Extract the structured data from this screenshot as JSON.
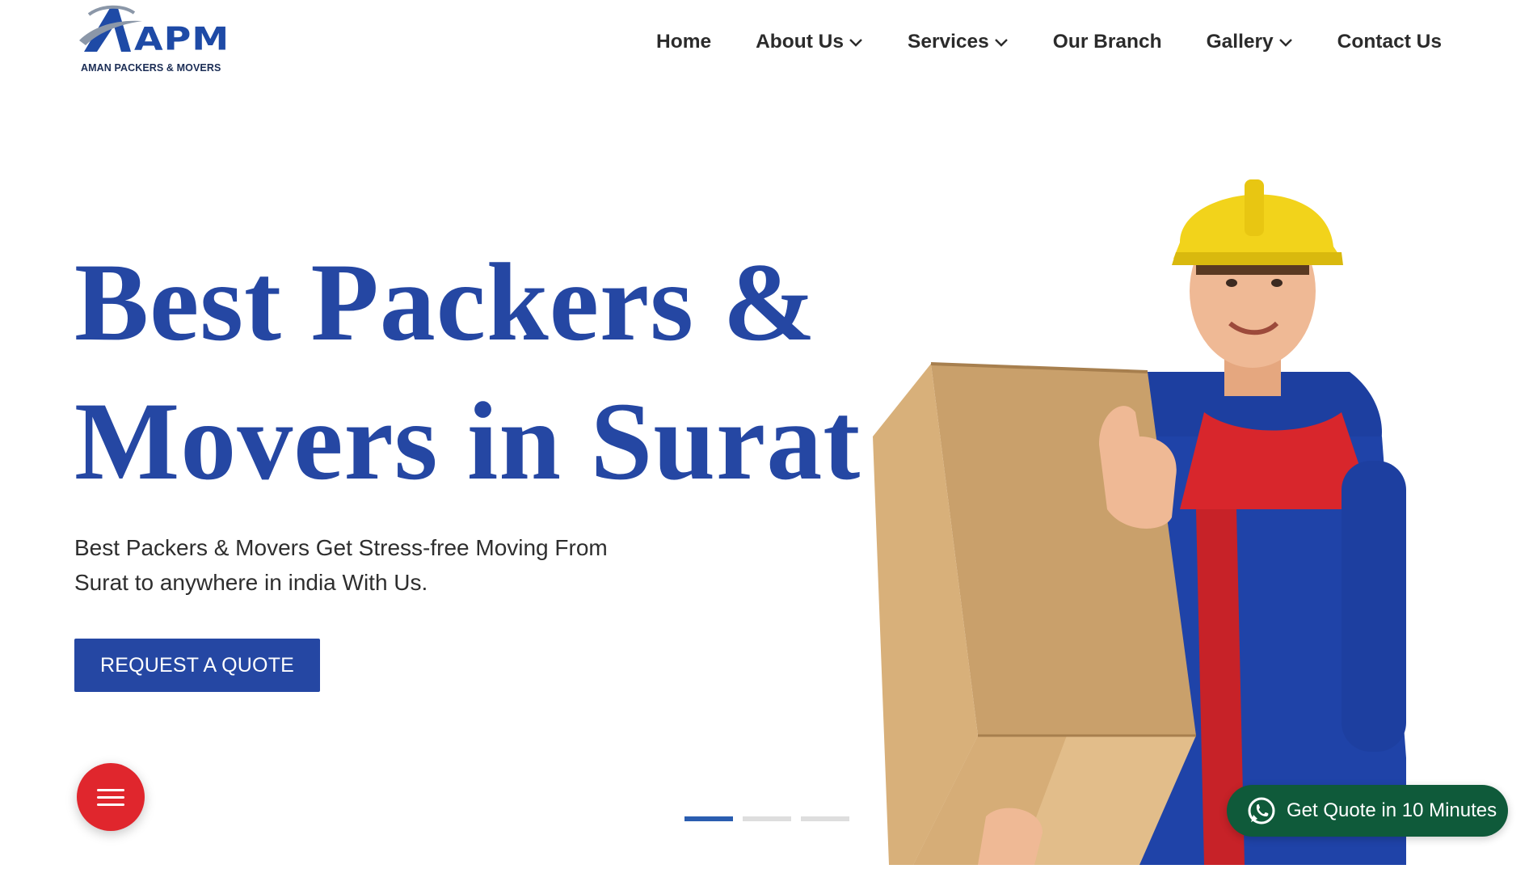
{
  "brand": {
    "logo_word": "APM",
    "logo_sub": "AMAN PACKERS & MOVERS",
    "primary_color": "#2547a3",
    "accent_red": "#e0262d",
    "whatsapp_green": "#0f5a3a"
  },
  "nav": {
    "items": [
      {
        "label": "Home",
        "has_dropdown": false
      },
      {
        "label": "About Us",
        "has_dropdown": true
      },
      {
        "label": "Services",
        "has_dropdown": true
      },
      {
        "label": "Our Branch",
        "has_dropdown": false
      },
      {
        "label": "Gallery",
        "has_dropdown": true
      },
      {
        "label": "Contact Us",
        "has_dropdown": false
      }
    ]
  },
  "hero": {
    "title_line1": "Best Packers &",
    "title_line2": "Movers in Surat",
    "subtitle_line1": "Best Packers & Movers Get Stress-free Moving From",
    "subtitle_line2": "Surat to anywhere in india With Us.",
    "cta_label": "REQUEST A QUOTE",
    "image_icon": "mover-holding-box-illustration"
  },
  "slider": {
    "total_slides": 3,
    "active_slide": 1
  },
  "floating": {
    "menu_icon": "hamburger-icon",
    "whatsapp_icon": "whatsapp-icon",
    "whatsapp_label": "Get Quote in 10 Minutes"
  }
}
